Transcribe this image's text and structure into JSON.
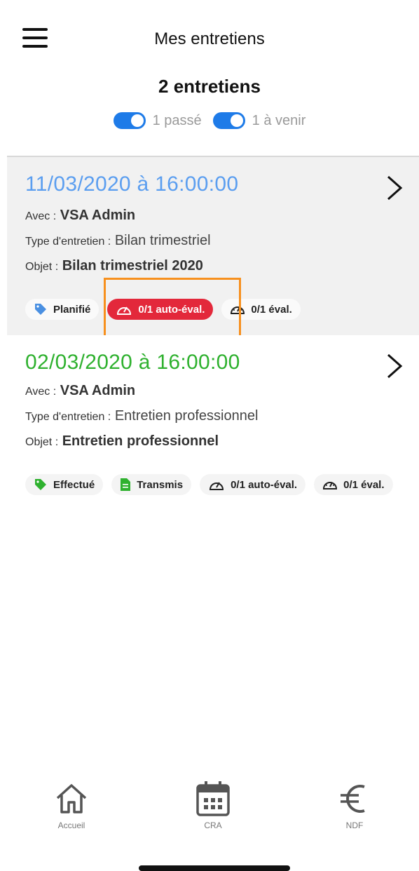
{
  "header": {
    "title": "Mes entretiens"
  },
  "summary": {
    "count": "2 entretiens",
    "filters": [
      {
        "label": "1 passé",
        "on": true
      },
      {
        "label": "1 à venir",
        "on": true
      }
    ]
  },
  "interviews": [
    {
      "date": "11/03/2020 à 16:00:00",
      "date_color": "#5b9ef0",
      "avec_label": "Avec :",
      "avec": "VSA Admin",
      "type_label": "Type d'entretien :",
      "type": "Bilan trimestriel",
      "objet_label": "Objet :",
      "objet": "Bilan trimestriel 2020",
      "badges": [
        {
          "label": "Planifié",
          "icon": "tag-icon",
          "icon_color": "#4a90e2"
        },
        {
          "label": "0/1 auto-éval.",
          "icon": "gauge-icon",
          "style": "red"
        },
        {
          "label": "0/1 éval.",
          "icon": "dashboard-icon"
        }
      ]
    },
    {
      "date": "02/03/2020 à 16:00:00",
      "date_color": "#2fb12f",
      "avec_label": "Avec :",
      "avec": "VSA Admin",
      "type_label": "Type d'entretien :",
      "type": "Entretien professionnel",
      "objet_label": "Objet :",
      "objet": "Entretien professionnel",
      "badges": [
        {
          "label": "Effectué",
          "icon": "tag-icon",
          "icon_color": "#2fb12f"
        },
        {
          "label": "Transmis",
          "icon": "document-icon",
          "icon_color": "#2fb12f"
        },
        {
          "label": "0/1 auto-éval.",
          "icon": "gauge-icon"
        },
        {
          "label": "0/1 éval.",
          "icon": "dashboard-icon"
        }
      ]
    }
  ],
  "nav": [
    {
      "label": "Accueil",
      "icon": "home-icon"
    },
    {
      "label": "CRA",
      "icon": "calendar-icon"
    },
    {
      "label": "NDF",
      "icon": "euro-icon"
    }
  ]
}
